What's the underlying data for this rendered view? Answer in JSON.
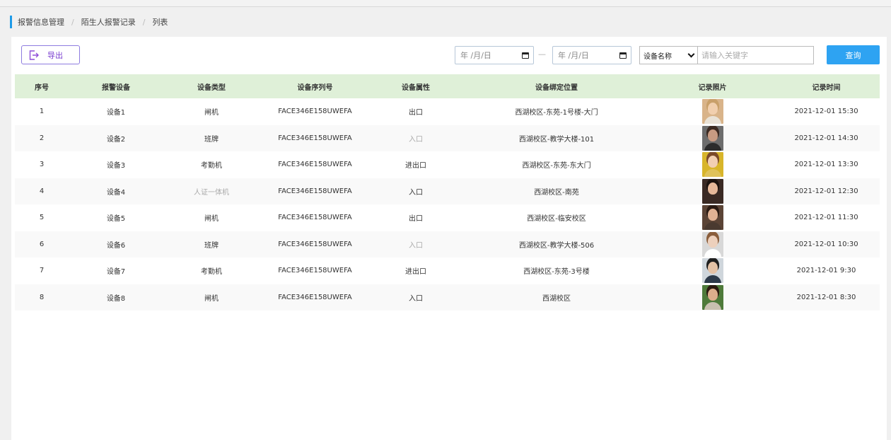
{
  "breadcrumb": [
    "报警信息管理",
    "陌生人报警记录",
    "列表"
  ],
  "toolbar": {
    "export_label": "导出",
    "date_start_placeholder": "年 /月/日",
    "date_end_placeholder": "年 /月/日",
    "device_select_value": "设备名称",
    "keyword_placeholder": "请输入关键字",
    "search_label": "查询"
  },
  "table": {
    "headers": [
      "序号",
      "报警设备",
      "设备类型",
      "设备序列号",
      "设备属性",
      "设备绑定位置",
      "记录照片",
      "记录时间"
    ],
    "rows": [
      {
        "no": "1",
        "device": "设备1",
        "type": "闸机",
        "serial": "FACE346E158UWEFA",
        "attr": "出口",
        "location": "西湖校区-东苑-1号楼-大门",
        "time": "2021-12-01 15:30",
        "photo": {
          "bg": "#d9b48a",
          "skin": "#f1cfae",
          "hair": "#c9a06a",
          "shirt": "#e9e2d6"
        }
      },
      {
        "no": "2",
        "device": "设备2",
        "type": "班牌",
        "serial": "FACE346E158UWEFA",
        "attr": "入口",
        "location": "西湖校区-教学大楼-101",
        "time": "2021-12-01 14:30",
        "photo": {
          "bg": "#6d6d6d",
          "skin": "#c89b82",
          "hair": "#3b2a22",
          "shirt": "#2c2c2c"
        }
      },
      {
        "no": "3",
        "device": "设备3",
        "type": "考勤机",
        "serial": "FACE346E158UWEFA",
        "attr": "进出口",
        "location": "西湖校区-东苑-东大门",
        "time": "2021-12-01 13:30",
        "photo": {
          "bg": "#d8b52a",
          "skin": "#f2cfb2",
          "hair": "#7b4a2a",
          "shirt": "#e0c25a"
        }
      },
      {
        "no": "4",
        "device": "设备4",
        "type": "人证一体机",
        "serial": "FACE346E158UWEFA",
        "attr": "入口",
        "location": "西湖校区-南苑",
        "time": "2021-12-01 12:30",
        "photo": {
          "bg": "#3a2a24",
          "skin": "#e6b899",
          "hair": "#1c130f",
          "shirt": "#3a2a24"
        }
      },
      {
        "no": "5",
        "device": "设备5",
        "type": "闸机",
        "serial": "FACE346E158UWEFA",
        "attr": "出口",
        "location": "西湖校区-临安校区",
        "time": "2021-12-01 11:30",
        "photo": {
          "bg": "#5b4436",
          "skin": "#e1b293",
          "hair": "#2a1a12",
          "shirt": "#4a3a30"
        }
      },
      {
        "no": "6",
        "device": "设备6",
        "type": "班牌",
        "serial": "FACE346E158UWEFA",
        "attr": "入口",
        "location": "西湖校区-教学大楼-506",
        "time": "2021-12-01 10:30",
        "photo": {
          "bg": "#d8d8d8",
          "skin": "#edd0bc",
          "hair": "#8a5e3c",
          "shirt": "#ffffff"
        }
      },
      {
        "no": "7",
        "device": "设备7",
        "type": "考勤机",
        "serial": "FACE346E158UWEFA",
        "attr": "进出口",
        "location": "西湖校区-东苑-3号楼",
        "time": "2021-12-01 9:30",
        "photo": {
          "bg": "#cfd6dc",
          "skin": "#e4c2a6",
          "hair": "#1f1f1f",
          "shirt": "#2d3a4a"
        }
      },
      {
        "no": "8",
        "device": "设备8",
        "type": "闸机",
        "serial": "FACE346E158UWEFA",
        "attr": "入口",
        "location": "西湖校区",
        "time": "2021-12-01 8:30",
        "photo": {
          "bg": "#4e7a3a",
          "skin": "#dcae8c",
          "hair": "#2b1a10",
          "shirt": "#c8c0b0"
        }
      }
    ],
    "muted_cells": [
      [
        1,
        "attr"
      ],
      [
        3,
        "type"
      ],
      [
        5,
        "attr"
      ]
    ]
  },
  "colors": {
    "accent": "#2ea3f2",
    "export_border": "#8e7ce0",
    "header_bg": "#dff0d8"
  }
}
